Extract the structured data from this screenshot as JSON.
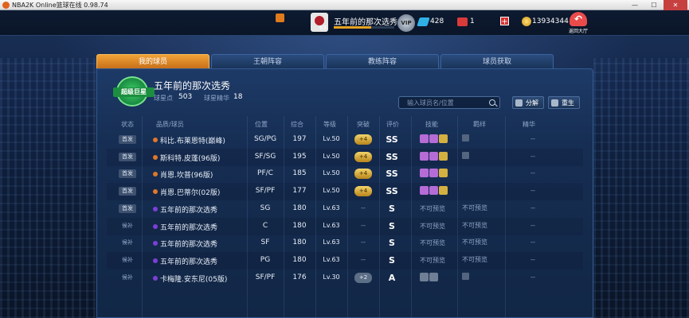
{
  "window": {
    "title": "NBA2K Online篮球在线 0.98.74",
    "minimize": "—",
    "maximize": "☐",
    "close": "✕"
  },
  "topbar": {
    "team_level": "63",
    "team_name": "五年前的那次选秀",
    "xp_fraction": 0.62,
    "vip_label": "VIP",
    "gems": "428",
    "tickets": "1",
    "add_label": "+",
    "coins": "13934344",
    "back_label": "返回大厅",
    "back_arrow": "↶"
  },
  "tabs": [
    {
      "label": "我的球员",
      "active": true
    },
    {
      "label": "王朝阵容",
      "active": false
    },
    {
      "label": "教练阵容",
      "active": false
    },
    {
      "label": "球员获取",
      "active": false
    }
  ],
  "lineup": {
    "badge_text": "超级巨星",
    "name": "五年前的那次选秀",
    "star_points_label": "球星点",
    "star_points": "503",
    "star_essence_label": "球星精华",
    "star_essence": "18"
  },
  "search": {
    "placeholder": "输入球员名/位置"
  },
  "buttons": {
    "decompose": "分解",
    "rebirth": "重生"
  },
  "table": {
    "headers": {
      "status": "状态",
      "name": "品质/球员",
      "position": "位置",
      "overall": "综合",
      "level": "等级",
      "breakthrough": "突破",
      "grade": "评价",
      "skills": "技能",
      "bond": "羁绊",
      "essence": "精华"
    },
    "rows": [
      {
        "status": "首发",
        "bench": false,
        "dot": "#e0772a",
        "name": "科比.布莱恩特(巅峰)",
        "position": "SG/PG",
        "overall": "197",
        "level": "Lv.50",
        "breakthrough": "+4",
        "break_style": "gold",
        "grade": "SS",
        "skills": 3,
        "skill_text": "",
        "bond": "icon",
        "essence": "--"
      },
      {
        "status": "首发",
        "bench": false,
        "dot": "#e0772a",
        "name": "斯科特.皮蓬(96版)",
        "position": "SF/SG",
        "overall": "195",
        "level": "Lv.50",
        "breakthrough": "+4",
        "break_style": "gold",
        "grade": "SS",
        "skills": 3,
        "skill_text": "",
        "bond": "icon",
        "essence": "--"
      },
      {
        "status": "首发",
        "bench": false,
        "dot": "#e0772a",
        "name": "肖恩.坎普(96版)",
        "position": "PF/C",
        "overall": "185",
        "level": "Lv.50",
        "breakthrough": "+4",
        "break_style": "gold",
        "grade": "SS",
        "skills": 3,
        "skill_text": "",
        "bond": "",
        "essence": "--"
      },
      {
        "status": "首发",
        "bench": false,
        "dot": "#e0772a",
        "name": "肖恩.巴蒂尔(02版)",
        "position": "SF/PF",
        "overall": "177",
        "level": "Lv.50",
        "breakthrough": "+4",
        "break_style": "gold",
        "grade": "SS",
        "skills": 3,
        "skill_text": "",
        "bond": "",
        "essence": "--"
      },
      {
        "status": "首发",
        "bench": false,
        "dot": "#7b3fd6",
        "name": "五年前的那次选秀",
        "position": "SG",
        "overall": "180",
        "level": "Lv.63",
        "breakthrough": "--",
        "break_style": "dash",
        "grade": "S",
        "skills": 0,
        "skill_text": "不可预览",
        "bond": "不可预览",
        "essence": "--"
      },
      {
        "status": "候补",
        "bench": true,
        "dot": "#7b3fd6",
        "name": "五年前的那次选秀",
        "position": "C",
        "overall": "180",
        "level": "Lv.63",
        "breakthrough": "--",
        "break_style": "dash",
        "grade": "S",
        "skills": 0,
        "skill_text": "不可预览",
        "bond": "不可预览",
        "essence": "--"
      },
      {
        "status": "候补",
        "bench": true,
        "dot": "#7b3fd6",
        "name": "五年前的那次选秀",
        "position": "SF",
        "overall": "180",
        "level": "Lv.63",
        "breakthrough": "--",
        "break_style": "dash",
        "grade": "S",
        "skills": 0,
        "skill_text": "不可预览",
        "bond": "不可预览",
        "essence": "--"
      },
      {
        "status": "候补",
        "bench": true,
        "dot": "#7b3fd6",
        "name": "五年前的那次选秀",
        "position": "PG",
        "overall": "180",
        "level": "Lv.63",
        "breakthrough": "--",
        "break_style": "dash",
        "grade": "S",
        "skills": 0,
        "skill_text": "不可预览",
        "bond": "不可预览",
        "essence": "--"
      },
      {
        "status": "候补",
        "bench": true,
        "dot": "#7b3fd6",
        "name": "卡梅隆.安东尼(05版)",
        "position": "SF/PF",
        "overall": "176",
        "level": "Lv.30",
        "breakthrough": "+2",
        "break_style": "gray",
        "grade": "A",
        "skills": 2,
        "skill_text": "",
        "bond": "icon",
        "essence": "--"
      }
    ]
  }
}
